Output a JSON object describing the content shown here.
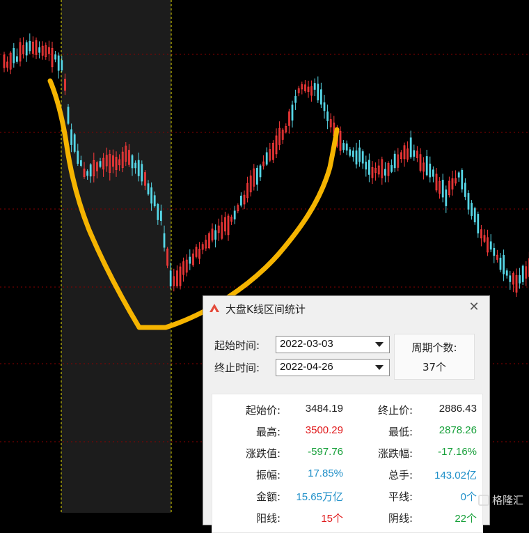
{
  "dialog": {
    "title": "大盘K线区间统计",
    "close_glyph": "✕",
    "start_label": "起始时间:",
    "end_label": "终止时间:",
    "start_date": "2022-03-03",
    "end_date": "2022-04-26",
    "period_label": "周期个数:",
    "period_value": "37个"
  },
  "stats": [
    {
      "k1": "起始价:",
      "v1": "3484.19",
      "c1": "black",
      "k2": "终止价:",
      "v2": "2886.43",
      "c2": "black"
    },
    {
      "k1": "最高:",
      "v1": "3500.29",
      "c1": "red",
      "k2": "最低:",
      "v2": "2878.26",
      "c2": "green"
    },
    {
      "k1": "涨跌值:",
      "v1": "-597.76",
      "c1": "green",
      "k2": "涨跌幅:",
      "v2": "-17.16%",
      "c2": "green"
    },
    {
      "k1": "振幅:",
      "v1": "17.85%",
      "c1": "blue",
      "k2": "总手:",
      "v2": "143.02亿",
      "c2": "blue"
    },
    {
      "k1": "金额:",
      "v1": "15.65万亿",
      "c1": "blue",
      "k2": "平线:",
      "v2": "0个",
      "c2": "blue"
    },
    {
      "k1": "阳线:",
      "v1": "15个",
      "c1": "red",
      "k2": "阴线:",
      "v2": "22个",
      "c2": "green"
    }
  ],
  "watermark": "格隆汇",
  "colors": {
    "up": "#ff3b3b",
    "down": "#56d6e6",
    "overlay": "#f5b400",
    "grid": "#8b0000",
    "highlight": "#1c1c1c",
    "selection_line": "#e8e000"
  }
}
